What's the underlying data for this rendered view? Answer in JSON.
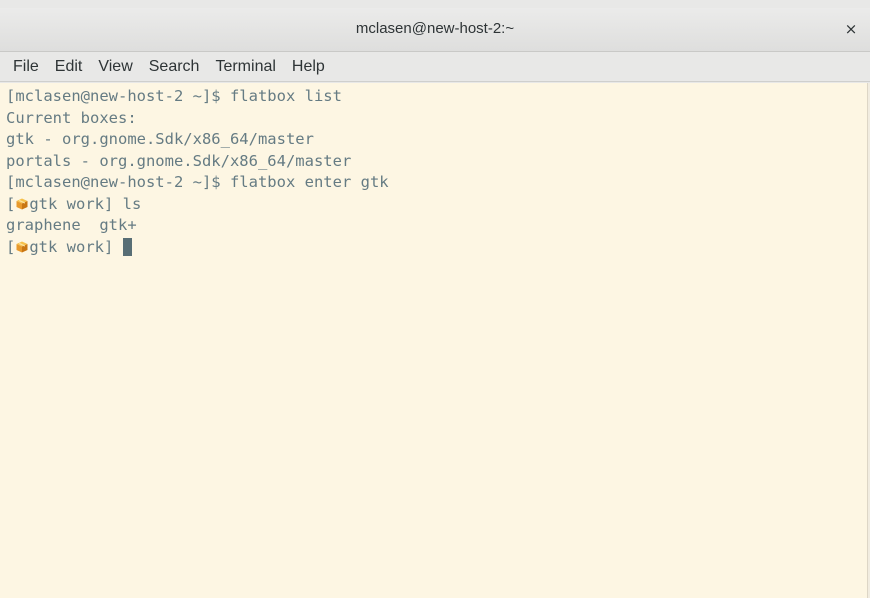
{
  "window": {
    "title": "mclasen@new-host-2:~",
    "close_glyph": "×"
  },
  "menubar": {
    "items": [
      "File",
      "Edit",
      "View",
      "Search",
      "Terminal",
      "Help"
    ]
  },
  "terminal": {
    "colors": {
      "background": "#fdf6e3",
      "foreground": "#657b83",
      "cursor": "#586e75"
    },
    "lines": [
      "[mclasen@new-host-2 ~]$ flatbox list",
      "Current boxes:",
      "gtk - org.gnome.Sdk/x86_64/master",
      "portals - org.gnome.Sdk/x86_64/master",
      "[mclasen@new-host-2 ~]$ flatbox enter gtk"
    ],
    "box_prompt": {
      "open": "[",
      "icon": "package-box-icon",
      "text": "gtk work] "
    },
    "box_lines": [
      {
        "command": "ls"
      },
      {
        "output": "graphene  gtk+"
      }
    ],
    "current_command": ""
  }
}
